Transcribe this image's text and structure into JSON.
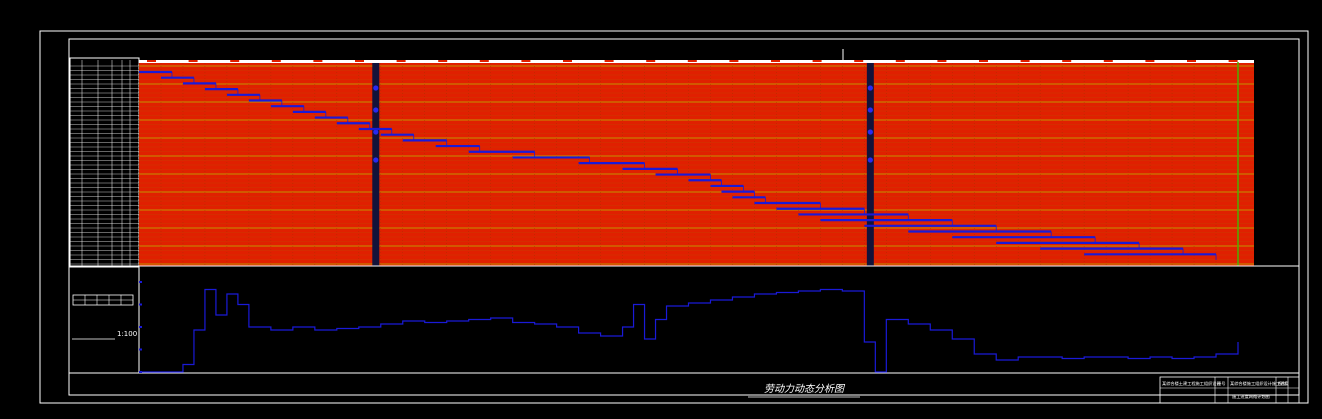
{
  "drawing": {
    "scale_label": "1:100",
    "caption": "劳动力动态分析图",
    "title_block": {
      "row1": [
        "某综合楼土建工程施工组织设计",
        "图号",
        "某综合楼施工组织设计施工进度",
        "图别"
      ],
      "row2": [
        "施工进度网络计划图"
      ]
    }
  },
  "chart_data": {
    "type": "gantt_with_histogram",
    "title": "劳动力动态分析图",
    "colors": {
      "background": "#000000",
      "grid_field": "#e02000",
      "bars": "#1a1ad8",
      "frame": "#ffffff",
      "gridline": "#b8b800",
      "milestone": "#13133a"
    },
    "gantt": {
      "rows": 44,
      "period": [
        0,
        100
      ],
      "milestones": [
        21.5,
        66.5
      ],
      "tasks": [
        [
          0,
          3
        ],
        [
          2,
          5
        ],
        [
          4,
          7
        ],
        [
          6,
          9
        ],
        [
          8,
          11
        ],
        [
          10,
          13
        ],
        [
          12,
          15
        ],
        [
          14,
          17
        ],
        [
          16,
          19
        ],
        [
          18,
          21
        ],
        [
          20,
          23
        ],
        [
          22,
          25
        ],
        [
          24,
          28
        ],
        [
          27,
          31
        ],
        [
          30,
          36
        ],
        [
          34,
          41
        ],
        [
          40,
          46
        ],
        [
          44,
          49
        ],
        [
          47,
          52
        ],
        [
          50,
          53
        ],
        [
          52,
          55
        ],
        [
          53,
          56
        ],
        [
          54,
          57
        ],
        [
          56,
          62
        ],
        [
          58,
          66
        ],
        [
          60,
          70
        ],
        [
          62,
          74
        ],
        [
          66,
          78
        ],
        [
          70,
          83
        ],
        [
          74,
          87
        ],
        [
          78,
          91
        ],
        [
          82,
          95
        ],
        [
          86,
          98
        ]
      ]
    },
    "histogram": {
      "x": [
        0,
        2,
        4,
        5,
        6,
        7,
        8,
        9,
        10,
        12,
        14,
        16,
        18,
        20,
        22,
        24,
        26,
        28,
        30,
        32,
        34,
        36,
        38,
        40,
        42,
        44,
        45,
        46,
        47,
        48,
        50,
        52,
        54,
        56,
        58,
        60,
        62,
        64,
        66,
        67,
        68,
        70,
        72,
        74,
        76,
        78,
        80,
        82,
        84,
        86,
        88,
        90,
        92,
        94,
        96,
        98,
        100
      ],
      "y": [
        0,
        0,
        5,
        28,
        55,
        38,
        52,
        45,
        30,
        28,
        30,
        28,
        29,
        30,
        32,
        34,
        33,
        34,
        35,
        36,
        33,
        32,
        30,
        26,
        24,
        30,
        45,
        22,
        35,
        44,
        46,
        48,
        50,
        52,
        53,
        54,
        55,
        54,
        20,
        0,
        35,
        32,
        28,
        22,
        12,
        8,
        10,
        10,
        9,
        10,
        10,
        9,
        10,
        9,
        10,
        12,
        20
      ]
    }
  }
}
